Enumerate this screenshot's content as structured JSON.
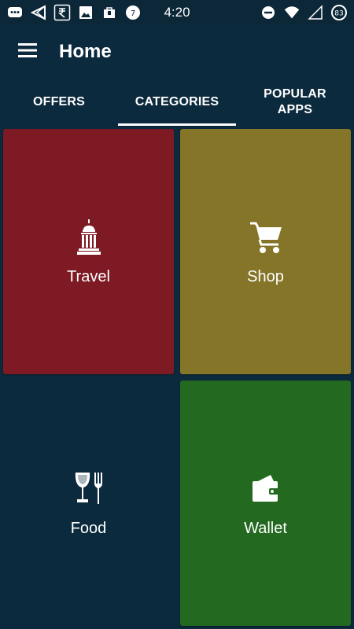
{
  "status_bar": {
    "time": "4:20",
    "battery_level": "83",
    "notification_icons": [
      "chat-icon",
      "send-icon",
      "rupee-icon",
      "image-icon",
      "bag-icon",
      "badge-icon"
    ],
    "system_icons": [
      "do-not-disturb-icon",
      "wifi-icon",
      "signal-icon",
      "battery-icon"
    ]
  },
  "app_bar": {
    "title": "Home",
    "menu_icon": "hamburger-icon"
  },
  "tabs": [
    {
      "label": "OFFERS",
      "active": false
    },
    {
      "label": "CATEGORIES",
      "active": true
    },
    {
      "label": "POPULAR\nAPPS",
      "active": false
    }
  ],
  "categories": [
    {
      "label": "Travel",
      "icon": "building-icon",
      "color": "#7e1a23"
    },
    {
      "label": "Shop",
      "icon": "cart-icon",
      "color": "#857528"
    },
    {
      "label": "Food",
      "icon": "food-icon",
      "color": "#0c2a3e"
    },
    {
      "label": "Wallet",
      "icon": "wallet-icon",
      "color": "#236a20"
    }
  ],
  "colors": {
    "background": "#0c2a3e",
    "status_bar": "#0b2738",
    "text": "#ffffff"
  }
}
